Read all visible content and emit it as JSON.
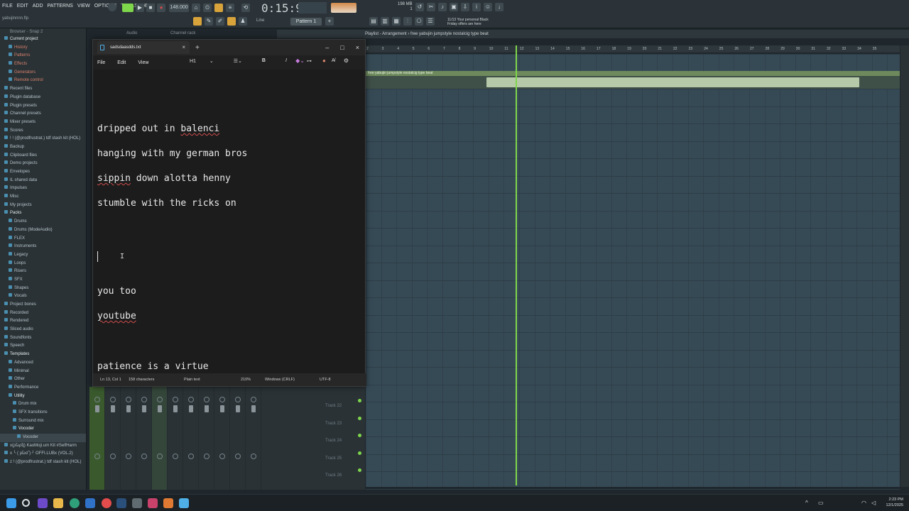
{
  "fl": {
    "menu": [
      "FILE",
      "EDIT",
      "ADD",
      "PATTERNS",
      "VIEW",
      "OPTIONS",
      "TOOLS",
      "HELP"
    ],
    "project_file": "yabujinnnn.flp",
    "tempo": "148.000",
    "time": "0:15:93",
    "pattern": "Pattern 1",
    "line_mode": "Line",
    "cpu": "198 MB",
    "cpu_sub": "1",
    "promo_line1": "11/13  Your personal Black",
    "promo_line2": "Friday offers are here",
    "playlist_label": "Playlist - Arrangement",
    "playlist_name": "free yabujin  jumpstyle nostalcig type beat",
    "channel_rack": "Channel rack",
    "audio_tab": "Audio",
    "browser_head": "Browser - Snap 2",
    "clip_name": "free yabujin  jumpstyle nostalcig type beat",
    "ruler_ticks": [
      "2",
      "3",
      "4",
      "5",
      "6",
      "7",
      "8",
      "9",
      "10",
      "11",
      "12",
      "13",
      "14",
      "15",
      "16",
      "17",
      "18",
      "19",
      "20",
      "21",
      "22",
      "23",
      "24",
      "25",
      "26",
      "27",
      "28",
      "29",
      "30",
      "31",
      "32",
      "33",
      "34",
      "35"
    ],
    "mixer_tracks": [
      "Track 22",
      "Track 23",
      "Track 24",
      "Track 25",
      "Track 26"
    ],
    "browser": [
      {
        "label": "Current project",
        "level": 1,
        "style": "hl"
      },
      {
        "label": "History",
        "level": 2,
        "style": "red"
      },
      {
        "label": "Patterns",
        "level": 2,
        "style": "red"
      },
      {
        "label": "Effects",
        "level": 2,
        "style": "red"
      },
      {
        "label": "Generators",
        "level": 2,
        "style": "red"
      },
      {
        "label": "Remote control",
        "level": 2,
        "style": "red"
      },
      {
        "label": "Recent files",
        "level": 1,
        "style": ""
      },
      {
        "label": "Plugin database",
        "level": 1,
        "style": ""
      },
      {
        "label": "Plugin presets",
        "level": 1,
        "style": ""
      },
      {
        "label": "Channel presets",
        "level": 1,
        "style": ""
      },
      {
        "label": "Mixer presets",
        "level": 1,
        "style": ""
      },
      {
        "label": "Scores",
        "level": 1,
        "style": ""
      },
      {
        "label": "! ! (@prodfrustrat.) tdf stash kit (HOL)",
        "level": 1,
        "style": ""
      },
      {
        "label": "Backup",
        "level": 1,
        "style": ""
      },
      {
        "label": "Clipboard files",
        "level": 1,
        "style": ""
      },
      {
        "label": "Demo projects",
        "level": 1,
        "style": ""
      },
      {
        "label": "Envelopes",
        "level": 1,
        "style": ""
      },
      {
        "label": "IL shared data",
        "level": 1,
        "style": ""
      },
      {
        "label": "Impulses",
        "level": 1,
        "style": ""
      },
      {
        "label": "Misc",
        "level": 1,
        "style": ""
      },
      {
        "label": "My projects",
        "level": 1,
        "style": ""
      },
      {
        "label": "Packs",
        "level": 1,
        "style": "hl"
      },
      {
        "label": "Drums",
        "level": 2,
        "style": ""
      },
      {
        "label": "Drums (ModeAudio)",
        "level": 2,
        "style": ""
      },
      {
        "label": "FLEX",
        "level": 2,
        "style": ""
      },
      {
        "label": "Instruments",
        "level": 2,
        "style": ""
      },
      {
        "label": "Legacy",
        "level": 2,
        "style": ""
      },
      {
        "label": "Loops",
        "level": 2,
        "style": ""
      },
      {
        "label": "Risers",
        "level": 2,
        "style": ""
      },
      {
        "label": "SFX",
        "level": 2,
        "style": ""
      },
      {
        "label": "Shapes",
        "level": 2,
        "style": ""
      },
      {
        "label": "Vocals",
        "level": 2,
        "style": ""
      },
      {
        "label": "Project bones",
        "level": 1,
        "style": ""
      },
      {
        "label": "Recorded",
        "level": 1,
        "style": ""
      },
      {
        "label": "Rendered",
        "level": 1,
        "style": ""
      },
      {
        "label": "Sliced audio",
        "level": 1,
        "style": ""
      },
      {
        "label": "Soundfonts",
        "level": 1,
        "style": ""
      },
      {
        "label": "Speech",
        "level": 1,
        "style": ""
      },
      {
        "label": "Templates",
        "level": 1,
        "style": "hl"
      },
      {
        "label": "Advanced",
        "level": 2,
        "style": ""
      },
      {
        "label": "Minimal",
        "level": 2,
        "style": ""
      },
      {
        "label": "Other",
        "level": 2,
        "style": ""
      },
      {
        "label": "Performance",
        "level": 2,
        "style": ""
      },
      {
        "label": "Utility",
        "level": 2,
        "style": "hl"
      },
      {
        "label": "Drum mix",
        "level": 3,
        "style": ""
      },
      {
        "label": "SFX transitions",
        "level": 3,
        "style": ""
      },
      {
        "label": "Surround mix",
        "level": 3,
        "style": ""
      },
      {
        "label": "Vocoder",
        "level": 3,
        "style": "hl"
      },
      {
        "label": "Vocoder",
        "level": 4,
        "style": "sel"
      },
      {
        "label": "x(ρ̃ωρ̃q) KaoMoji.um Kit #SelfHarm",
        "level": 1,
        "style": ""
      },
      {
        "label": "x ╰ ( ρ̃ωσ̃ ) ╯ OFFI.LUBx (VOL.2)",
        "level": 1,
        "style": ""
      },
      {
        "label": "z ! (@prodfrustrat.) tdf stash kit (HOL)",
        "level": 1,
        "style": ""
      }
    ]
  },
  "notepad": {
    "tab_title": "sadsdaasdds.txt",
    "menu": [
      "File",
      "Edit",
      "View"
    ],
    "heading_select": "H1",
    "lines": [
      {
        "text": "dripped out in balenci",
        "squiggle": "balenci"
      },
      {
        "text": "hanging with my german bros",
        "squiggle": ""
      },
      {
        "text": "sippin down alotta henny",
        "squiggle": "sippin"
      },
      {
        "text": "stumble with the ricks on",
        "squiggle": ""
      },
      {
        "text": "you too",
        "squiggle": ""
      },
      {
        "text": "youtube",
        "squiggle": "youtube"
      },
      {
        "text": "patience is a virtue",
        "squiggle": ""
      }
    ],
    "status": {
      "position": "Ln 13, Col 1",
      "chars": "158 characters",
      "format": "Plain text",
      "zoom": "210%",
      "eol": "Windows (CRLF)",
      "encoding": "UTF-8"
    }
  },
  "taskbar": {
    "time": "2:23 PM",
    "date": "12/1/2025"
  }
}
